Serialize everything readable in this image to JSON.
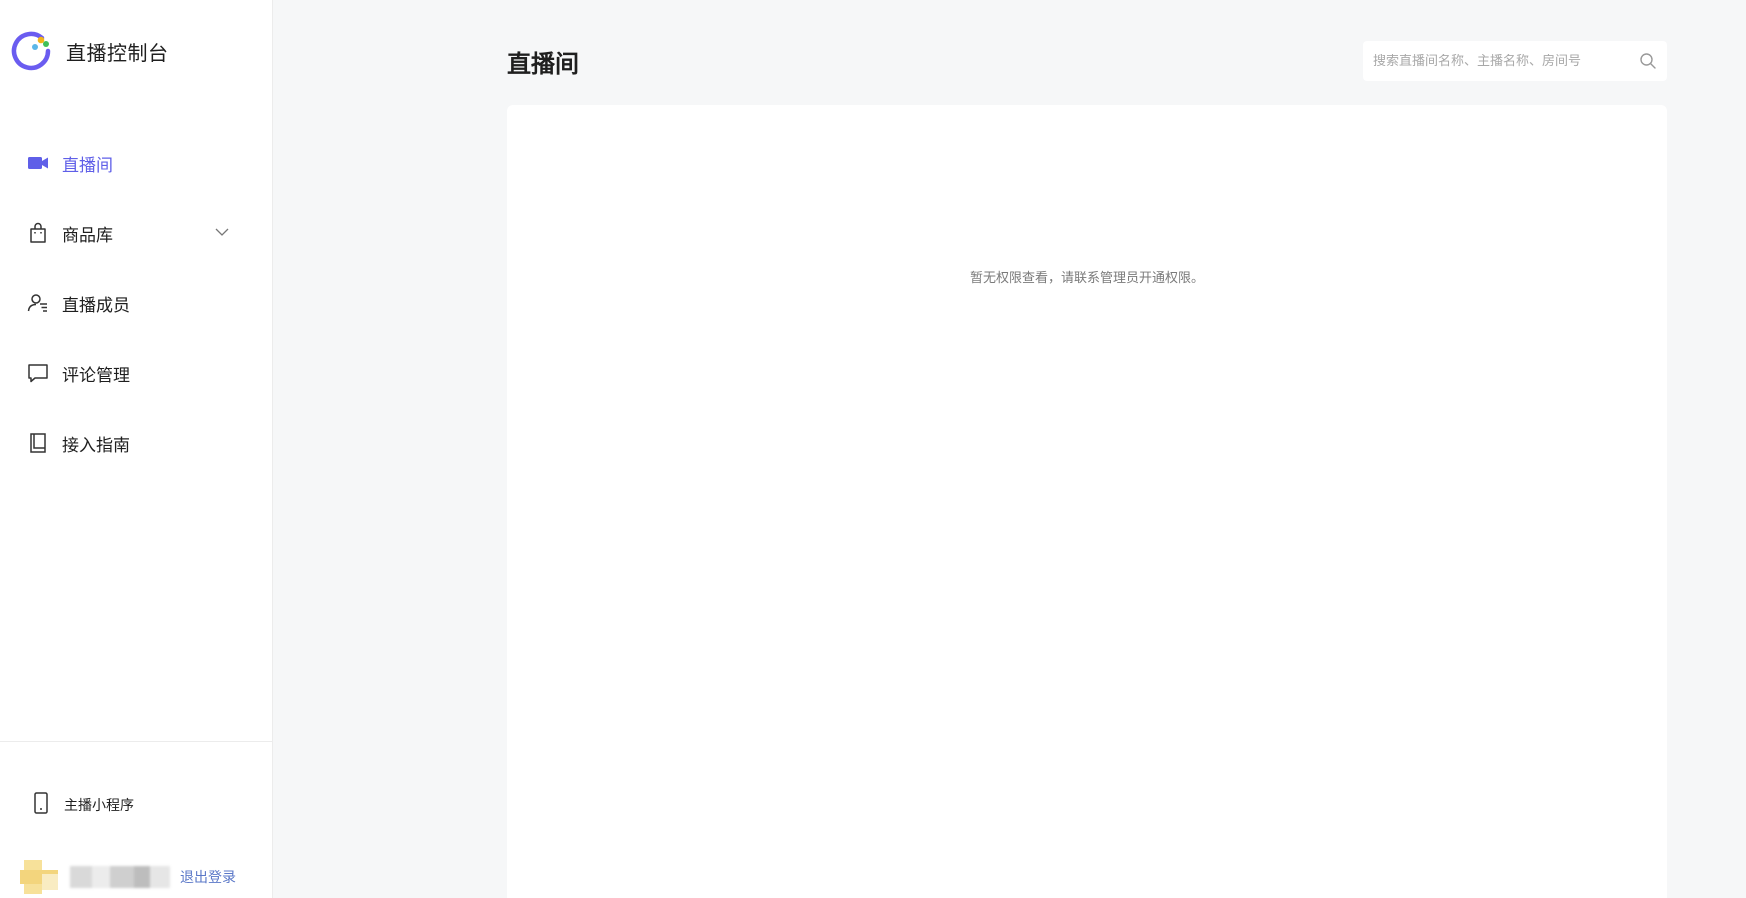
{
  "sidebar": {
    "brand_title": "直播控制台",
    "items": [
      {
        "label": "直播间",
        "icon": "video-camera-icon",
        "active": true
      },
      {
        "label": "商品库",
        "icon": "shopping-bag-icon",
        "active": false,
        "has_submenu": true
      },
      {
        "label": "直播成员",
        "icon": "member-list-icon",
        "active": false
      },
      {
        "label": "评论管理",
        "icon": "comment-icon",
        "active": false
      },
      {
        "label": "接入指南",
        "icon": "book-icon",
        "active": false
      }
    ],
    "mini_program_label": "主播小程序",
    "logout_label": "退出登录"
  },
  "main": {
    "title": "直播间",
    "search_placeholder": "搜索直播间名称、主播名称、房间号",
    "empty_message": "暂无权限查看，请联系管理员开通权限。"
  },
  "colors": {
    "accent": "#5f5fe8",
    "background": "#f6f7f8",
    "panel": "#ffffff",
    "link": "#5b78c8"
  }
}
